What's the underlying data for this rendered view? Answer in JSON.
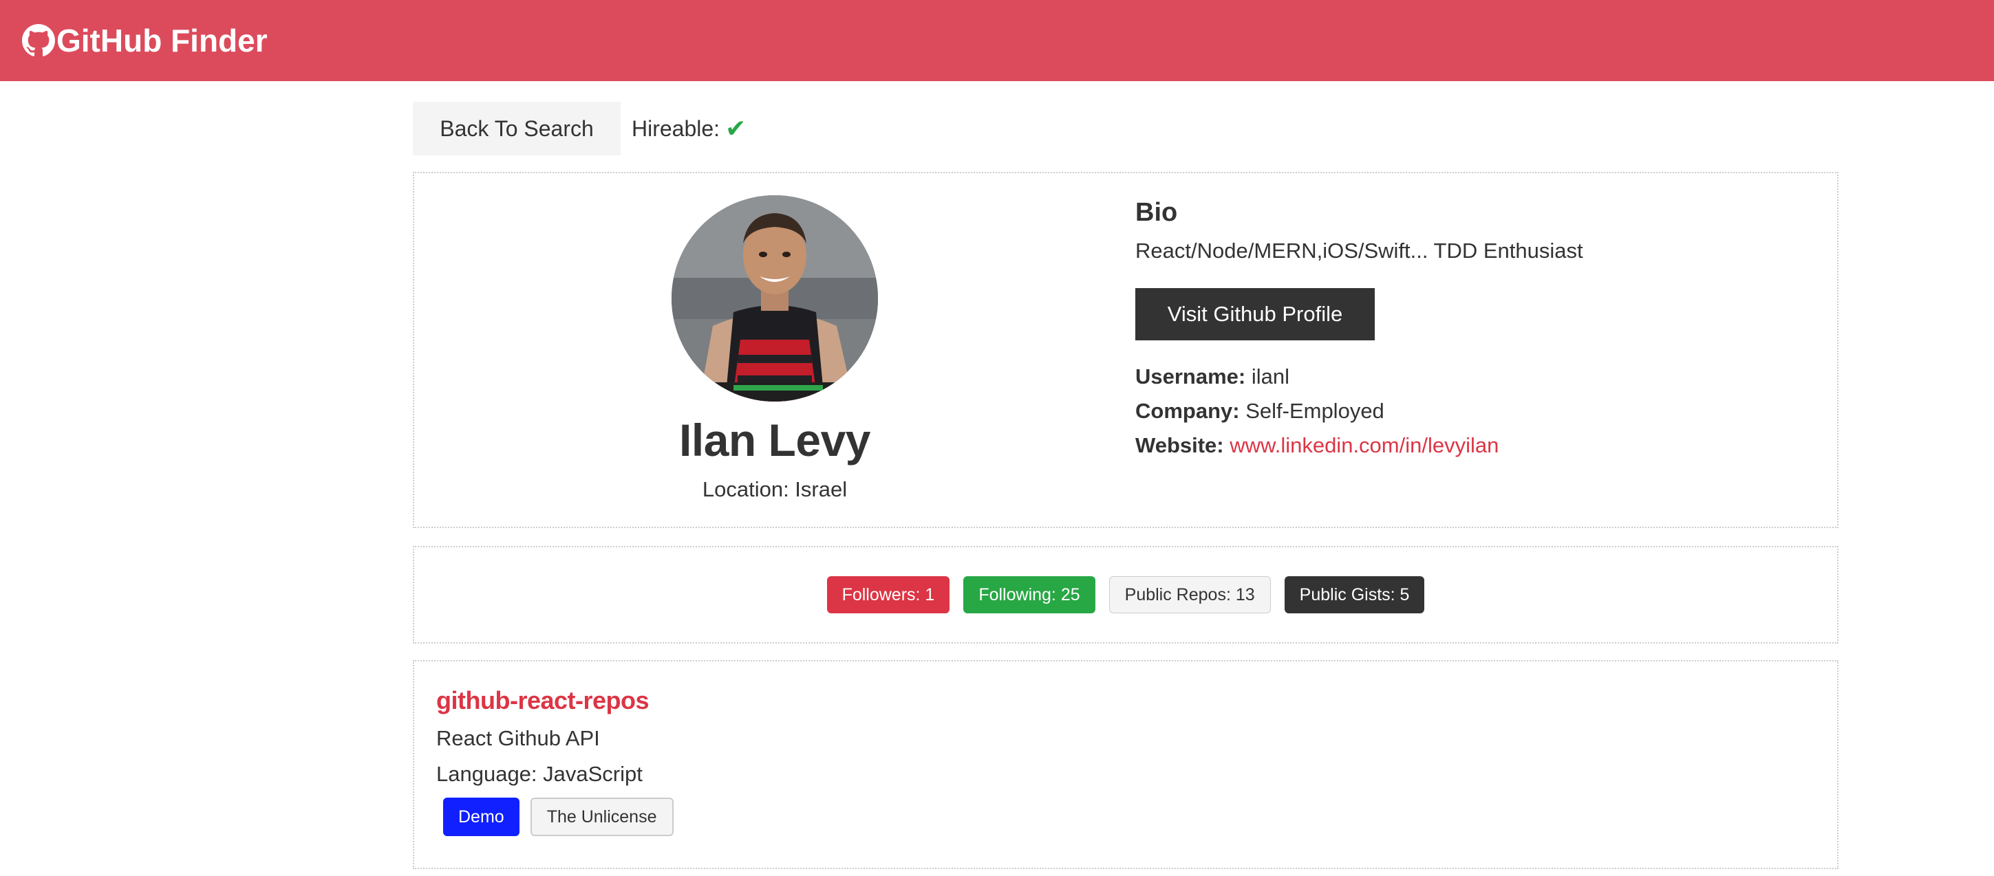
{
  "navbar": {
    "title": "GitHub Finder",
    "icon": "github-icon"
  },
  "toolbar": {
    "back_label": "Back To Search",
    "hireable_label": "Hireable:",
    "hireable_icon": "check-icon"
  },
  "profile": {
    "name": "Ilan Levy",
    "location_label": "Location: Israel",
    "bio_title": "Bio",
    "bio_text": "React/Node/MERN,iOS/Swift... TDD Enthusiast",
    "visit_label": "Visit Github Profile",
    "username_label": "Username:",
    "username_value": "ilanl",
    "company_label": "Company:",
    "company_value": "Self-Employed",
    "website_label": "Website:",
    "website_value": "www.linkedin.com/in/levyilan"
  },
  "stats": {
    "followers": "Followers: 1",
    "following": "Following: 25",
    "public_repos": "Public Repos: 13",
    "public_gists": "Public Gists: 5"
  },
  "repos": [
    {
      "name": "github-react-repos",
      "description": "React Github API",
      "language": "Language: JavaScript",
      "demo_label": "Demo",
      "license_label": "The Unlicense"
    }
  ],
  "colors": {
    "navbar": "#dc4b5c",
    "danger": "#dc3545",
    "success": "#28a745",
    "dark": "#333333",
    "light": "#f4f4f4",
    "demo_blue": "#1020ff"
  }
}
